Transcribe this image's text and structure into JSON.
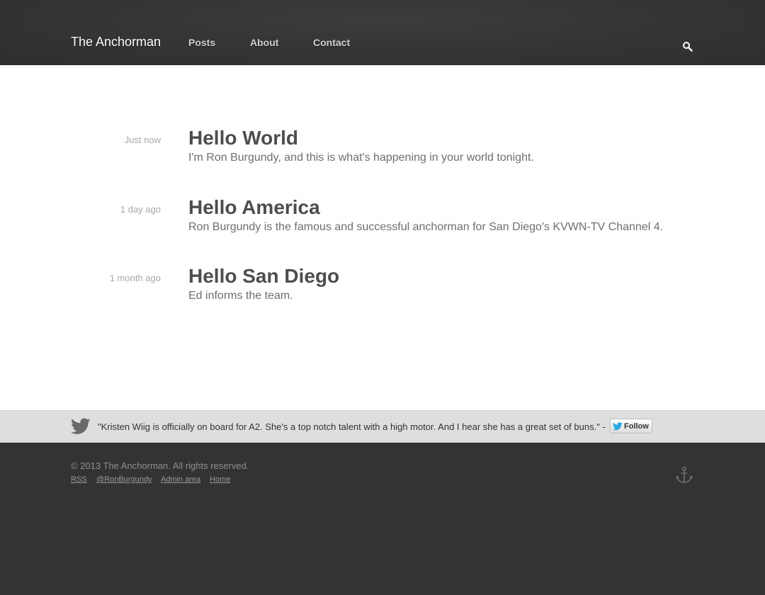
{
  "header": {
    "site_title": "The Anchorman",
    "nav": [
      {
        "label": "Posts"
      },
      {
        "label": "About"
      },
      {
        "label": "Contact"
      }
    ],
    "search_icon": "search-icon"
  },
  "posts": [
    {
      "date": "Just now",
      "title": "Hello World",
      "excerpt": "I'm Ron Burgundy, and this is what's happening in your world tonight."
    },
    {
      "date": "1 day ago",
      "title": "Hello America",
      "excerpt": "Ron Burgundy is the famous and successful anchorman for San Diego's KVWN-TV Channel 4."
    },
    {
      "date": "1 month ago",
      "title": "Hello San Diego",
      "excerpt": "Ed informs the team."
    }
  ],
  "twitter": {
    "icon": "twitter-bird-icon",
    "tweet": "\"Kristen Wiig is officially on board for A2. She's a top notch talent with a high motor. And I hear she has a great set of buns.\" -",
    "follow_label": "Follow"
  },
  "footer": {
    "copyright": "© 2013 The Anchorman. All rights reserved.",
    "links": [
      {
        "label": "RSS"
      },
      {
        "label": "@RonBurgundy"
      },
      {
        "label": "Admin area"
      },
      {
        "label": "Home"
      }
    ],
    "anchor_icon": "anchor-icon"
  },
  "colors": {
    "header_bg": "#353535",
    "content_bg": "#ffffff",
    "tweet_bar_bg": "#dedede",
    "footer_bg": "#333333",
    "title_text": "#4d4d4d",
    "twitter_blue": "#2aa9e0"
  }
}
